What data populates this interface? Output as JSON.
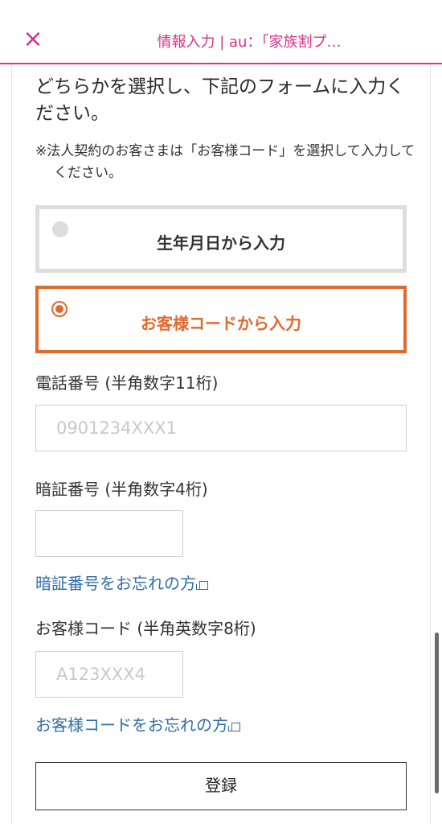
{
  "header": {
    "close_icon": "×",
    "title": "情報入力 | au：「家族割プ…"
  },
  "form": {
    "instruction": "どちらかを選択し、下記のフォームに入力ください。",
    "note": "※法人契約のお客さまは「お客様コード」を選択して入力してください。",
    "options": [
      {
        "label": "生年月日から入力",
        "selected": false
      },
      {
        "label": "お客様コードから入力",
        "selected": true
      }
    ],
    "phone": {
      "label": "電話番号 (半角数字11桁)",
      "placeholder": "0901234XXX1",
      "value": ""
    },
    "pin": {
      "label": "暗証番号 (半角数字4桁)",
      "placeholder": "",
      "value": "",
      "forgot_link": "暗証番号をお忘れの方"
    },
    "customer_code": {
      "label": "お客様コード (半角英数字8桁)",
      "placeholder": "A123XXX4",
      "value": "",
      "forgot_link": "お客様コードをお忘れの方"
    },
    "submit_label": "登録"
  },
  "colors": {
    "brand": "#d4338a",
    "accent": "#e06a2c",
    "link": "#2f6fa8"
  }
}
